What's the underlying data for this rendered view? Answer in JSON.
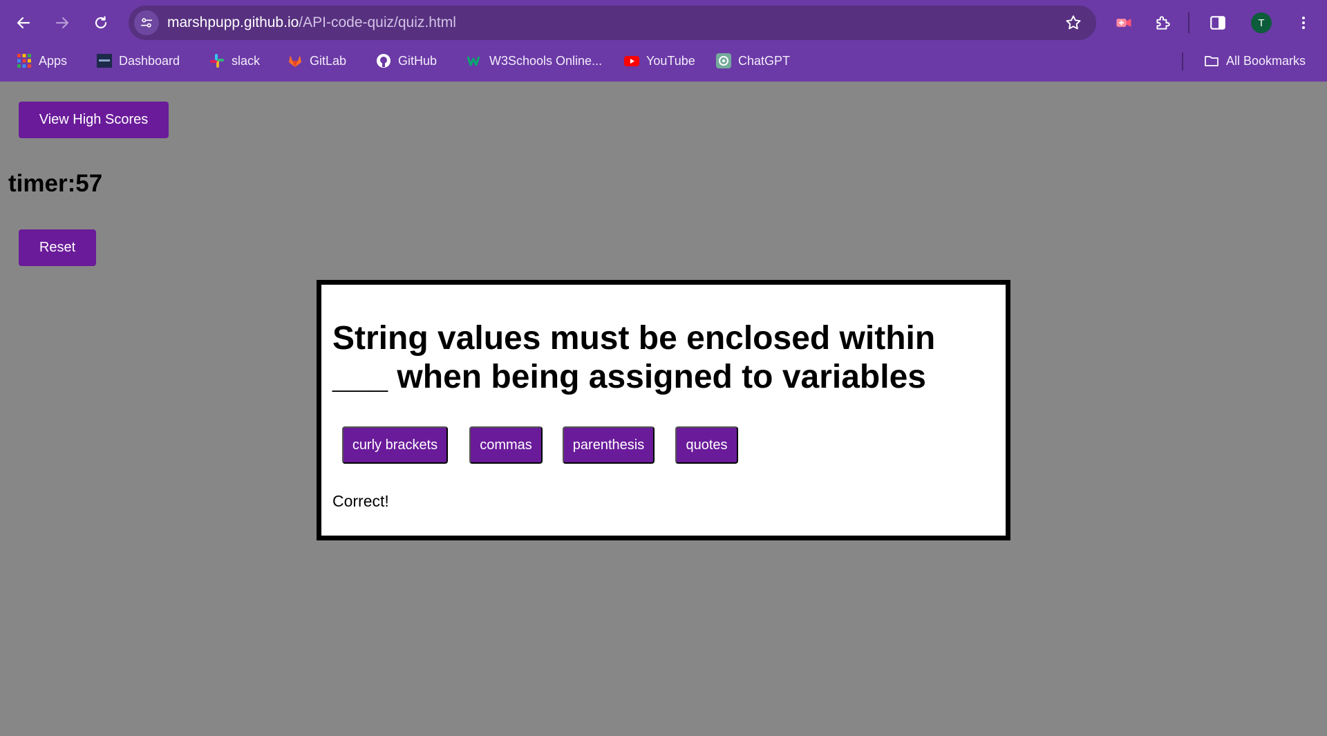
{
  "browser": {
    "url_host": "marshpupp.github.io",
    "url_path": "/API-code-quiz/quiz.html",
    "profile_initial": "T",
    "bookmarks": [
      {
        "label": "Apps",
        "icon": "apps-grid-icon"
      },
      {
        "label": "Dashboard",
        "icon": "dashboard-icon"
      },
      {
        "label": "slack",
        "icon": "slack-icon"
      },
      {
        "label": "GitLab",
        "icon": "gitlab-icon"
      },
      {
        "label": "GitHub",
        "icon": "github-icon"
      },
      {
        "label": "W3Schools Online...",
        "icon": "w3schools-icon"
      },
      {
        "label": "YouTube",
        "icon": "youtube-icon"
      },
      {
        "label": "ChatGPT",
        "icon": "chatgpt-icon"
      }
    ],
    "all_bookmarks_label": "All Bookmarks"
  },
  "page": {
    "view_high_scores_label": "View High Scores",
    "timer_text": "timer:57",
    "reset_label": "Reset"
  },
  "quiz": {
    "question": "String values must be enclosed within ___ when being assigned to variables",
    "choices": [
      "curly brackets",
      "commas",
      "parenthesis",
      "quotes"
    ],
    "feedback": "Correct!"
  },
  "colors": {
    "chrome": "#6b3aa6",
    "page_background": "#878787",
    "button": "#6a1b9a"
  }
}
